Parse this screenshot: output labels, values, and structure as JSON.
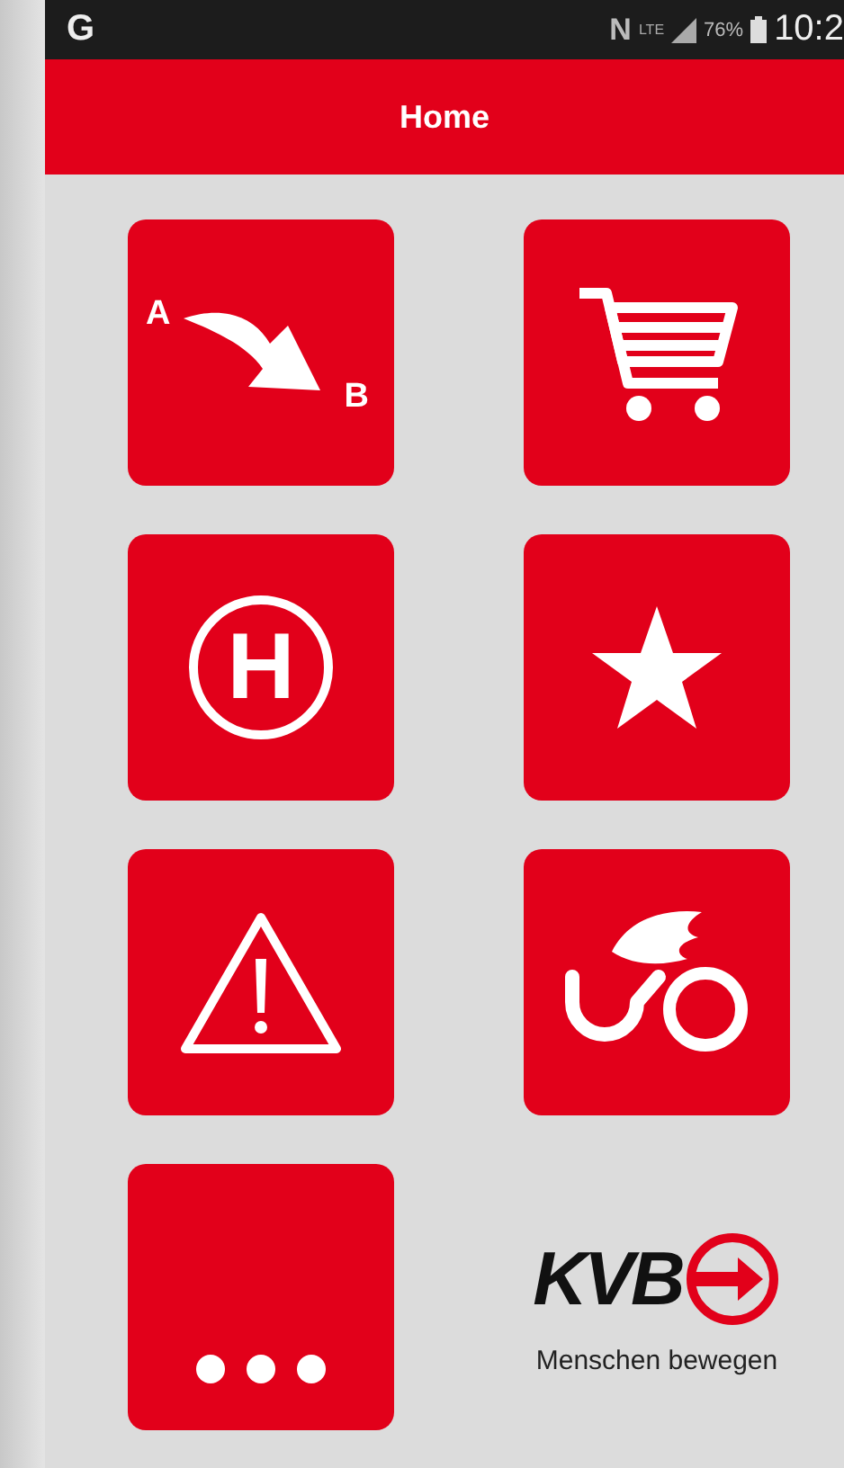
{
  "status_bar": {
    "app_letter": "G",
    "nfc": "N",
    "network": "LTE",
    "battery": "76%",
    "time": "10:2"
  },
  "header": {
    "title": "Home"
  },
  "tiles": [
    {
      "kind": "route",
      "labels": [
        "A",
        "B"
      ]
    },
    {
      "kind": "cart"
    },
    {
      "kind": "stop",
      "labels": [
        "H"
      ]
    },
    {
      "kind": "star"
    },
    {
      "kind": "warning"
    },
    {
      "kind": "bike"
    },
    {
      "kind": "more"
    }
  ],
  "logo": {
    "wordmark": "KVB",
    "tagline": "Menschen bewegen"
  }
}
